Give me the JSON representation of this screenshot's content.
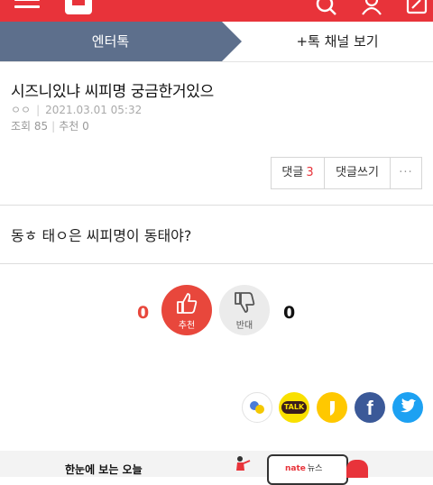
{
  "topbar": {
    "icons": [
      "menu-icon",
      "nate-logo",
      "search-icon",
      "user-icon",
      "edit-icon"
    ],
    "color": "#e8333a"
  },
  "channel": {
    "active_tab": "엔터톡",
    "link": "+톡 채널 보기",
    "tab_color": "#5d6f8c"
  },
  "post": {
    "title": "시즈니있냐 씨피명 궁금한거있으",
    "author": "ㅇㅇ",
    "date": "2021.03.01 05:32",
    "views": "조회 85",
    "recommend": "추천 0",
    "body": "동ㅎ 태ㅇ은 씨피명이 동태야?"
  },
  "actions": {
    "comment_label": "댓글",
    "comment_count": "3",
    "write_label": "댓글쓰기",
    "more_label": "···"
  },
  "vote": {
    "up_count": "0",
    "up_label": "추천",
    "down_count": "0",
    "down_label": "반대"
  },
  "share": {
    "talk_label": "TALK",
    "facebook_label": "f",
    "icons": [
      "wechat-icon",
      "kakaotalk-icon",
      "kakaostory-icon",
      "facebook-icon",
      "twitter-icon"
    ]
  },
  "banner": {
    "text": "한눈에 보는 오늘",
    "brand": "nate",
    "brand_suffix": "뉴스"
  }
}
